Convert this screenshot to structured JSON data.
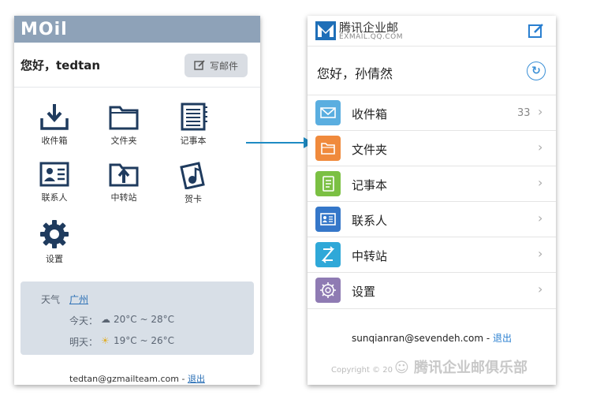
{
  "old_ui": {
    "logo": "MOil",
    "greeting": "您好，tedtan",
    "write_button": "写邮件",
    "apps": [
      {
        "label": "收件箱",
        "icon": "inbox-download-icon"
      },
      {
        "label": "文件夹",
        "icon": "folder-icon"
      },
      {
        "label": "记事本",
        "icon": "notebook-icon"
      },
      {
        "label": "联系人",
        "icon": "contact-card-icon"
      },
      {
        "label": "中转站",
        "icon": "upload-folder-icon"
      },
      {
        "label": "贺卡",
        "icon": "greeting-card-icon"
      },
      {
        "label": "设置",
        "icon": "gear-icon"
      }
    ],
    "weather": {
      "label": "天气",
      "city": "广州",
      "today_label": "今天：",
      "today_value": "20°C ~ 28°C",
      "tomorrow_label": "明天：",
      "tomorrow_value": "19°C ~ 26°C"
    },
    "footer_email": "tedtan@gzmailteam.com - ",
    "footer_logout": "退出"
  },
  "new_ui": {
    "brand": "腾讯企业邮",
    "brand_sub": "EXMAIL.QQ.COM",
    "greeting": "您好，孙倩然",
    "menu": [
      {
        "label": "收件箱",
        "count": "33",
        "color": "#5aaee0",
        "icon": "mail-icon"
      },
      {
        "label": "文件夹",
        "count": "",
        "color": "#f08a3c",
        "icon": "folder-icon"
      },
      {
        "label": "记事本",
        "count": "",
        "color": "#7bc043",
        "icon": "note-icon"
      },
      {
        "label": "联系人",
        "count": "",
        "color": "#3577c9",
        "icon": "contact-card-icon"
      },
      {
        "label": "中转站",
        "count": "",
        "color": "#2fa8d8",
        "icon": "transfer-icon"
      },
      {
        "label": "设置",
        "count": "",
        "color": "#8f7bb3",
        "icon": "gear-icon"
      }
    ],
    "email": "sunqianran@sevendeh.com - ",
    "logout": "退出",
    "copyright": "Copyright © 20"
  },
  "watermark": "腾讯企业邮俱乐部",
  "colors": {
    "arrow": "#1e8bc3",
    "old_header": "#8ea2b8",
    "link": "#2a6fb5"
  }
}
